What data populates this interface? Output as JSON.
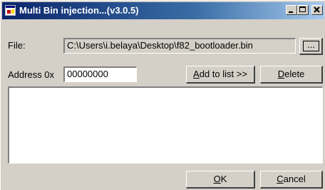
{
  "window": {
    "title": "Multi Bin injection...(v3.0.5)",
    "buttons": {
      "minimize": "_",
      "maximize": "□",
      "close": "x"
    }
  },
  "file": {
    "label": "File:",
    "value": "C:\\Users\\i.belaya\\Desktop\\f82_bootloader.bin",
    "browse_label": "..."
  },
  "address": {
    "label": "Address 0x",
    "value": "00000000"
  },
  "buttons": {
    "add_to_list_prefix": "A",
    "add_to_list_rest": "dd to list >>",
    "delete_prefix": "D",
    "delete_rest": "elete",
    "ok_prefix": "O",
    "ok_rest": "K",
    "cancel_prefix": "C",
    "cancel_rest": "ancel"
  },
  "colors": {
    "title_start": "#0a246a",
    "title_end": "#a6caf0",
    "face": "#d4d0c8"
  }
}
